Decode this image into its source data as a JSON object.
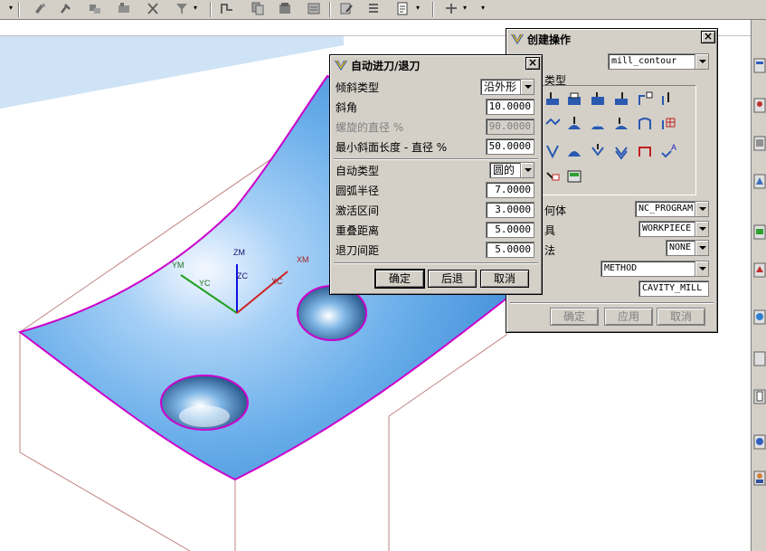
{
  "toolbar": {
    "icons": [
      "drill-icon",
      "tool-icon",
      "tool-change-icon",
      "fixture-icon",
      "cut-icon",
      "filter-icon",
      "path-icon",
      "copy-icon",
      "stack-icon",
      "layer-icon",
      "edit-icon",
      "list-icon",
      "doc-icon",
      "transform-icon"
    ]
  },
  "approach_dialog": {
    "title": "自动进刀/退刀",
    "ramp_type_label": "倾斜类型",
    "ramp_type_value": "沿外形",
    "ramp_angle_label": "斜角",
    "ramp_angle_value": "10.0000",
    "helix_diameter_label": "螺旋的直径 %",
    "helix_diameter_value": "90.0000",
    "min_ramp_length_label": "最小斜面长度 - 直径 %",
    "min_ramp_length_value": "50.0000",
    "auto_type_label": "自动类型",
    "auto_type_value": "圆的",
    "arc_radius_label": "圆弧半径",
    "arc_radius_value": "7.0000",
    "activation_label": "激活区间",
    "activation_value": "3.0000",
    "overlap_label": "重叠距离",
    "overlap_value": "5.0000",
    "retract_label": "退刀间距",
    "retract_value": "5.0000",
    "ok_label": "确定",
    "back_label": "后退",
    "cancel_label": "取消"
  },
  "create_op_dialog": {
    "title": "创建操作",
    "type_value": "mill_contour",
    "subtype_label_fragment": "类型",
    "program_value": "NC_PROGRAM",
    "geometry_label_fragment": "何体",
    "geometry_value": "WORKPIECE",
    "tool_label_fragment": "具",
    "tool_value": "NONE",
    "method_label_fragment": "法",
    "method_value": "METHOD",
    "name_value": "CAVITY_MILL",
    "ok_label": "确定",
    "apply_label": "应用",
    "cancel_label": "取消"
  },
  "viewport": {
    "axis_labels": {
      "zm": "ZM",
      "ym": "YM",
      "xm": "XM",
      "zc": "ZC",
      "yc": "YC",
      "xc": "XC"
    }
  },
  "colors": {
    "dialog_bg": "#d4d0c8",
    "surface": "#69aee6",
    "edge_highlight": "#cc00cc",
    "wireframe": "#c08080"
  }
}
